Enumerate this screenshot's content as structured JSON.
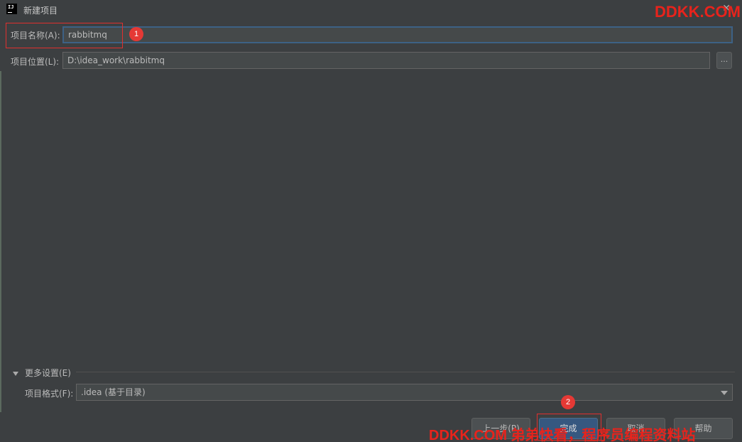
{
  "window": {
    "title": "新建项目",
    "logo_text": "IJ",
    "close_glyph": "✕"
  },
  "form": {
    "name_label": "项目名称(A):",
    "name_value": "rabbitmq",
    "location_label": "项目位置(L):",
    "location_value": "D:\\idea_work\\rabbitmq",
    "browse_label": "..."
  },
  "more_settings": {
    "header": "更多设置(E)",
    "format_label": "项目格式(F):",
    "format_value": ".idea (基于目录)"
  },
  "buttons": {
    "previous": "上一步(P)",
    "finish": "完成",
    "cancel": "取消",
    "help": "帮助"
  },
  "annotations": {
    "step1": "1",
    "step2": "2"
  },
  "watermarks": {
    "top": "DDKK.COM",
    "bottom": "DDKK.COM 弟弟快看，程序员编程资料站"
  },
  "colors": {
    "background": "#3c3f41",
    "accent": "#365880",
    "annotation_red": "#e53935"
  },
  "icons": {
    "logo": "intellij-logo-icon",
    "close": "close-icon",
    "expand": "triangle-down-icon",
    "dropdown": "chevron-down-icon"
  }
}
